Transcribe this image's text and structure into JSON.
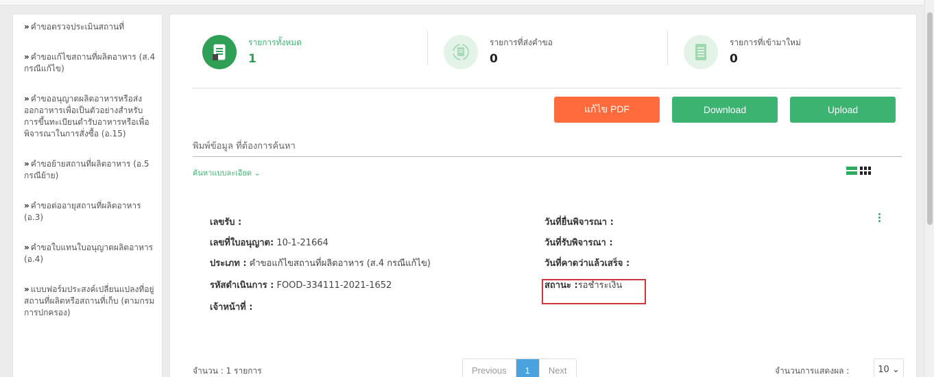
{
  "sidebar": {
    "items": [
      {
        "label": "คำขอตรวจประเมินสถานที่"
      },
      {
        "label": "คำขอแก้ไขสถานที่ผลิตอาหาร (ส.4 กรณีแก้ไข)"
      },
      {
        "label": "คำขออนุญาตผลิตอาหารหรือส่งออกอาหารเพื่อเป็นตัวอย่างสำหรับการขึ้นทะเบียนตำรับอาหารหรือเพื่อพิจารณาในการสั่งซื้อ (อ.15)"
      },
      {
        "label": "คำขอย้ายสถานที่ผลิตอาหาร (อ.5 กรณีย้าย)"
      },
      {
        "label": "คำขอต่ออายุสถานที่ผลิตอาหาร (อ.3)"
      },
      {
        "label": "คำขอใบแทนใบอนุญาตผลิตอาหาร (อ.4)"
      },
      {
        "label": "แบบฟอร์มประสงค์เปลี่ยนแปลงที่อยู่สถานที่ผลิตหรือสถานที่เก็บ (ตามกรมการปกครอง)"
      }
    ]
  },
  "stats": [
    {
      "label": "รายการทั้งหมด",
      "count": "1",
      "icon": "document-icon"
    },
    {
      "label": "รายการที่ส่งคำขอ",
      "count": "0",
      "icon": "refresh-document-icon"
    },
    {
      "label": "รายการที่เข้ามาใหม่",
      "count": "0",
      "icon": "new-document-icon"
    }
  ],
  "toolbar": {
    "edit_pdf_label": "แก้ไข PDF",
    "download_label": "Download",
    "upload_label": "Upload"
  },
  "search": {
    "placeholder": "พิมพ์ข้อมูล ที่ต้องการค้นหา",
    "advanced_label": "ค้นหาแบบละเอียด ⌄"
  },
  "record": {
    "receipt_no_label": "เลขรับ :",
    "license_no_label": "เลขที่ใบอนุญาต:",
    "license_no": "10-1-21664",
    "type_label": "ประเภท :",
    "type_value": "คำขอแก้ไขสถานที่ผลิตอาหาร (ส.4 กรณีแก้ไข)",
    "process_code_label": "รหัสดำเนินการ :",
    "process_code": "FOOD-334111-2021-1652",
    "officer_label": "เจ้าหน้าที่ :",
    "submit_date_label": "วันที่ยื่นพิจารณา :",
    "receive_date_label": "วันที่รับพิจารณา :",
    "expected_date_label": "วันที่คาดว่าแล้วเสร็จ :",
    "status_label": "สถานะ :",
    "status_value": "รอชำระเงิน"
  },
  "footer": {
    "total_text": "จำนวน : 1 รายการ",
    "prev_label": "Previous",
    "page": "1",
    "next_label": "Next",
    "per_page_label": "จำนวนการแสดงผล :",
    "per_page_value": "10 ⌄"
  },
  "colors": {
    "accent_green": "#3cb371",
    "pdf_orange": "#ff6b3d",
    "status_border": "#d0343c",
    "pager_active": "#4aa3df"
  }
}
